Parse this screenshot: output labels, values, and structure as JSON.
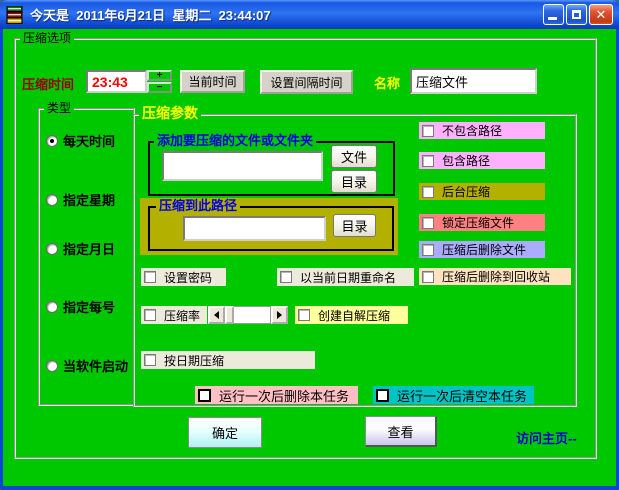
{
  "window": {
    "title": "今天是  2011年6月21日  星期二  23:44:07"
  },
  "icons": {
    "app": "books-stack",
    "minimize": "_",
    "maximize": "□",
    "close": "✕",
    "spin_up": "+",
    "spin_down": "−",
    "scroll_left": "◀",
    "scroll_right": "▶"
  },
  "groups": {
    "main": "压缩选项",
    "type": "类型",
    "params": "压缩参数",
    "source": "添加要压缩的文件或文件夹",
    "dest": "压缩到此路径"
  },
  "time_row": {
    "time_label": "压缩时间",
    "time_value": "23:43",
    "spin_up": "+",
    "spin_down": "−",
    "current_time_button": "当前时间",
    "interval_button": "设置间隔时间",
    "name_label": "名称",
    "name_value": "压缩文件"
  },
  "type_options": [
    {
      "label": "每天时间",
      "selected": true
    },
    {
      "label": "指定星期",
      "selected": false
    },
    {
      "label": "指定月日",
      "selected": false
    },
    {
      "label": "指定每号",
      "selected": false
    },
    {
      "label": "当软件启动",
      "selected": false
    }
  ],
  "source": {
    "input_value": "",
    "file_button": "文件",
    "dir_button": "目录"
  },
  "dest": {
    "input_value": "",
    "dir_button": "目录"
  },
  "right_checks": [
    {
      "label": "不包含路径",
      "bg": "#ffb0ff",
      "checked": false
    },
    {
      "label": "包含路径",
      "bg": "#ffb0ff",
      "checked": false
    },
    {
      "label": "后台压缩",
      "bg": "#b4b000",
      "checked": false
    },
    {
      "label": "锁定压缩文件",
      "bg": "#ff8080",
      "checked": false
    },
    {
      "label": "压缩后删除文件",
      "bg": "#acacff",
      "checked": false
    },
    {
      "label": "压缩后删除到回收站",
      "bg": "#ffe2c0",
      "checked": false
    }
  ],
  "mid_checks": {
    "password": {
      "label": "设置密码",
      "bg": "#ebeadb",
      "checked": false
    },
    "rename": {
      "label": "以当前日期重命名",
      "bg": "#ebeadb",
      "checked": false
    },
    "ratio": {
      "label": "压缩率",
      "bg": "#ebeadb",
      "checked": false
    },
    "sfx": {
      "label": "创建自解压缩",
      "bg": "#ffff9c",
      "checked": false
    },
    "by_date": {
      "label": "按日期压缩",
      "bg": "#ebeadb",
      "checked": false
    }
  },
  "bottom_checks": [
    {
      "label": "运行一次后删除本任务",
      "bg": "#ffc0c4",
      "checked": false
    },
    {
      "label": "运行一次后清空本任务",
      "bg": "#00c4c4",
      "checked": false
    }
  ],
  "footer": {
    "ok_button": "确定",
    "view_button": "查看",
    "homepage_link": "访问主页--"
  },
  "colors": {
    "background": "#00c800",
    "olive": "#b4b000",
    "time_label": "#990000",
    "time_value": "#ff0000",
    "name_label": "#ffff00",
    "params_label": "#ffff00",
    "legend_blue": "#0000e0",
    "link": "#0000cc"
  }
}
